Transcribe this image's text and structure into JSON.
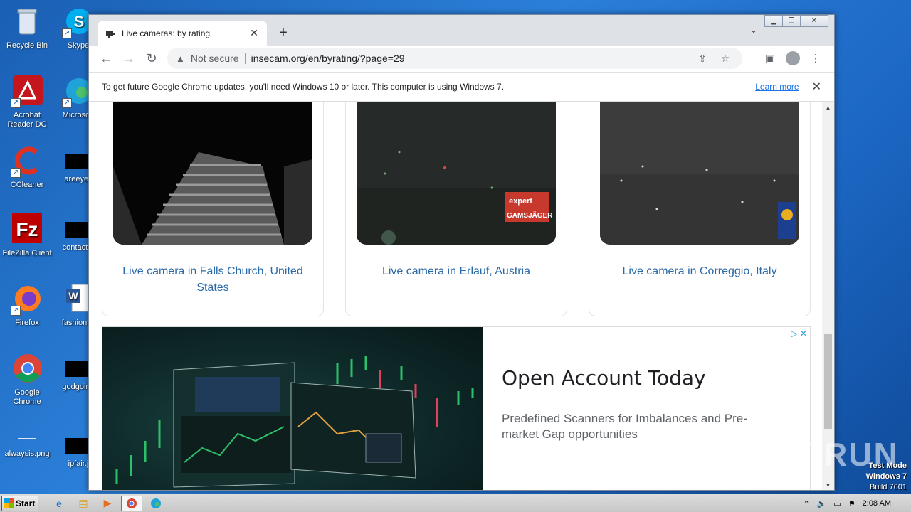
{
  "desktop": {
    "icons": [
      {
        "label": "Recycle Bin",
        "icon": "recycle-bin-icon"
      },
      {
        "label": "Skype",
        "icon": "skype-icon"
      },
      {
        "label": "Acrobat Reader DC",
        "icon": "acrobat-icon"
      },
      {
        "label": "Microsoft",
        "icon": "edge-icon"
      },
      {
        "label": "CCleaner",
        "icon": "ccleaner-icon"
      },
      {
        "label": "areeyes",
        "icon": "file-icon"
      },
      {
        "label": "FileZilla Client",
        "icon": "filezilla-icon"
      },
      {
        "label": "contactfri",
        "icon": "file-icon"
      },
      {
        "label": "Firefox",
        "icon": "firefox-icon"
      },
      {
        "label": "fashionsy",
        "icon": "word-icon"
      },
      {
        "label": "Google Chrome",
        "icon": "chrome-icon"
      },
      {
        "label": "godgoing",
        "icon": "file-icon"
      },
      {
        "label": "alwaysis.png",
        "icon": "image-icon"
      },
      {
        "label": "ipfair.j",
        "icon": "file-icon"
      }
    ]
  },
  "browser": {
    "tab_title": "Live cameras: by rating",
    "url_security": "Not secure",
    "url": "insecam.org/en/byrating/?page=29",
    "infobar_message": "To get future Google Chrome updates, you'll need Windows 10 or later. This computer is using Windows 7.",
    "infobar_link": "Learn more"
  },
  "page": {
    "cameras": [
      {
        "label": "Live camera in Falls Church, United States"
      },
      {
        "label": "Live camera in Erlauf, Austria",
        "overlay_line1": "expert",
        "overlay_line2": "GAMSJÄGER"
      },
      {
        "label": "Live camera in Correggio, Italy"
      }
    ],
    "ad": {
      "title": "Open Account Today",
      "body": "Predefined Scanners for Imbalances and Pre-market Gap opportunities"
    }
  },
  "watermark": "ANY RUN",
  "system": {
    "testmode_line1": "Test Mode",
    "testmode_line2": "Windows 7",
    "build": "Build 7601",
    "start_label": "Start",
    "clock": "2:08 AM"
  }
}
